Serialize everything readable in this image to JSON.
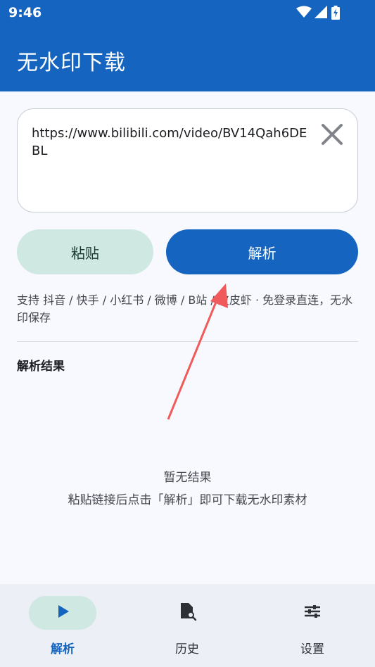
{
  "status": {
    "time": "9:46"
  },
  "header": {
    "title": "无水印下载"
  },
  "url_input": {
    "value": "https://www.bilibili.com/video/BV14Qah6DEBL"
  },
  "actions": {
    "paste_label": "粘贴",
    "parse_label": "解析"
  },
  "support_text": "支持 抖音 / 快手 / 小红书 / 微博 / B站 / 皮皮虾 · 免登录直连，无水印保存",
  "results": {
    "title": "解析结果",
    "empty_title": "暂无结果",
    "empty_hint": "粘贴链接后点击「解析」即可下载无水印素材"
  },
  "nav": {
    "items": [
      {
        "label": "解析",
        "icon": "play-icon",
        "active": true
      },
      {
        "label": "历史",
        "icon": "history-icon",
        "active": false
      },
      {
        "label": "设置",
        "icon": "settings-icon",
        "active": false
      }
    ]
  },
  "colors": {
    "primary": "#1565c0",
    "tonal": "#cfe8e1",
    "annotation_arrow": "#f05a5a"
  }
}
